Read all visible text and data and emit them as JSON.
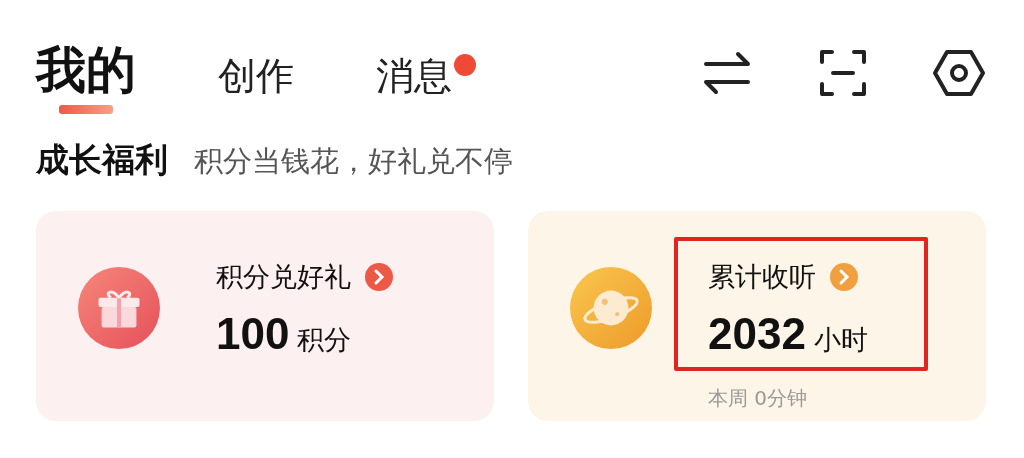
{
  "tabs": [
    {
      "label": "我的",
      "selected": true,
      "badge": false
    },
    {
      "label": "创作",
      "selected": false,
      "badge": false
    },
    {
      "label": "消息",
      "selected": false,
      "badge": true
    }
  ],
  "section": {
    "title": "成长福利",
    "subtitle": "积分当钱花，好礼兑不停"
  },
  "cards": [
    {
      "kind": "gift",
      "title": "积分兑好礼",
      "value": "100",
      "unit": "积分",
      "highlighted": false
    },
    {
      "kind": "planet",
      "title": "累计收听",
      "value": "2032",
      "unit": "小时",
      "note": "本周 0分钟",
      "highlighted": true
    }
  ]
}
